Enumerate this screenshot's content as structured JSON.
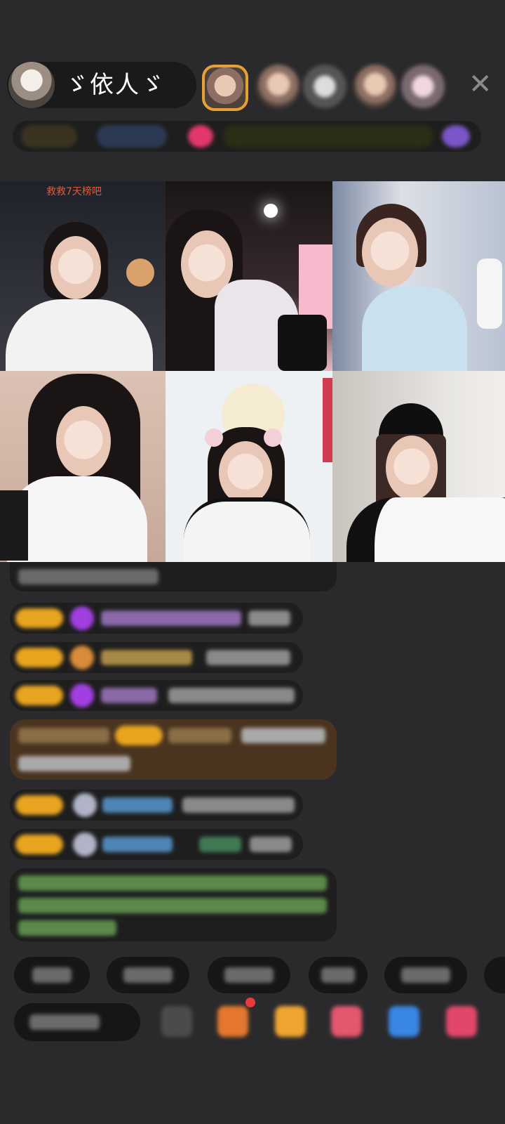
{
  "host": {
    "name": "ゞ依人ゞ"
  },
  "top_bar": {
    "close_icon": "close-icon"
  },
  "video_grid": {
    "cells": [
      {
        "overlay_text": "救救7天榜吧"
      },
      {
        "overlay_text": ""
      },
      {
        "overlay_text": ""
      },
      {
        "overlay_text": ""
      },
      {
        "overlay_text": ""
      },
      {
        "overlay_text": ""
      }
    ]
  },
  "colors": {
    "background": "#2a2a2c",
    "level_badge": "#e8a520",
    "highlight_message": "#5a3a1a",
    "system_text": "#79c36a"
  }
}
